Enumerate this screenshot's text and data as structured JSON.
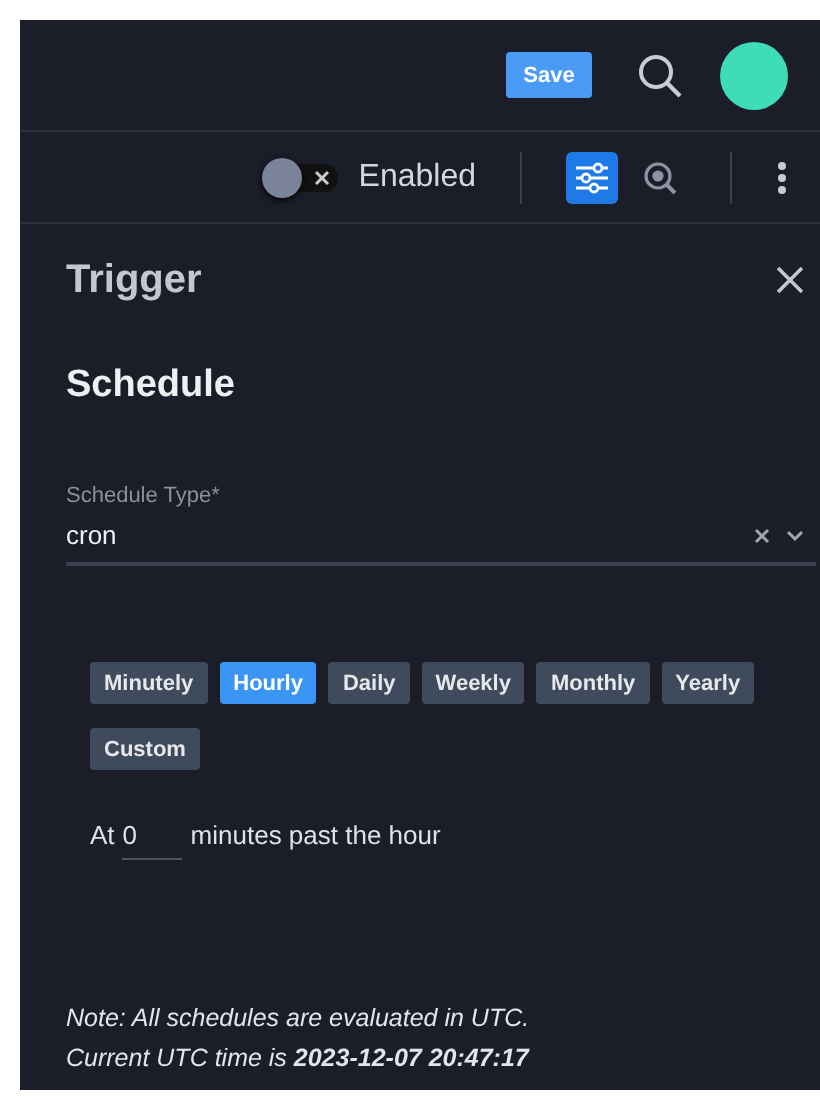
{
  "header": {
    "save_button": "Save"
  },
  "toolbar": {
    "toggle": {
      "label": "Enabled",
      "on": false
    },
    "tools": [
      {
        "kind": "sliders",
        "selected": true
      },
      {
        "kind": "inspect",
        "selected": false
      }
    ]
  },
  "panel": {
    "title": "Trigger"
  },
  "section_title": "Schedule",
  "schedule_type": {
    "label": "Schedule Type*",
    "value": "cron"
  },
  "frequencies": [
    {
      "label": "Minutely",
      "selected": false
    },
    {
      "label": "Hourly",
      "selected": true
    },
    {
      "label": "Daily",
      "selected": false
    },
    {
      "label": "Weekly",
      "selected": false
    },
    {
      "label": "Monthly",
      "selected": false
    },
    {
      "label": "Yearly",
      "selected": false
    },
    {
      "label": "Custom",
      "selected": false
    }
  ],
  "minute_field": {
    "prefix": "At",
    "value": "0",
    "suffix": "minutes past the hour"
  },
  "note": [
    "Note: All schedules are evaluated in UTC.",
    "Current UTC time is **2023-12-07 20:47:17**"
  ]
}
